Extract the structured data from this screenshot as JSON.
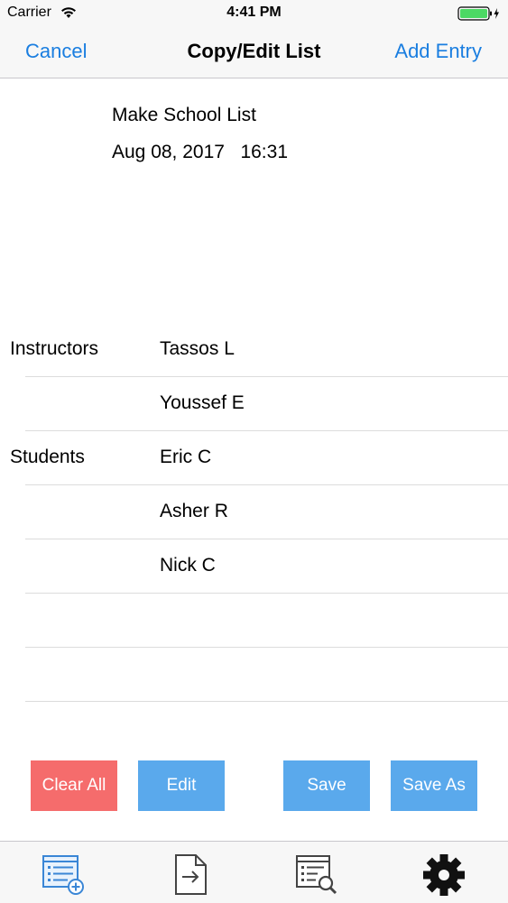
{
  "status_bar": {
    "carrier": "Carrier",
    "time": "4:41 PM",
    "battery_color": "#4cd964"
  },
  "nav": {
    "left_label": "Cancel",
    "title": "Copy/Edit List",
    "right_label": "Add Entry"
  },
  "list": {
    "title": "Make School List",
    "datetime": "Aug 08, 2017   16:31"
  },
  "rows": [
    {
      "group": "Instructors",
      "name": "Tassos L"
    },
    {
      "group": "",
      "name": "Youssef E"
    },
    {
      "group": "Students",
      "name": "Eric C"
    },
    {
      "group": "",
      "name": "Asher R"
    },
    {
      "group": "",
      "name": "Nick C"
    },
    {
      "group": "",
      "name": ""
    },
    {
      "group": "",
      "name": ""
    }
  ],
  "buttons": {
    "clear_all": "Clear All",
    "edit": "Edit",
    "save": "Save",
    "save_as": "Save As"
  },
  "colors": {
    "accent": "#1a7ee0",
    "clear_button": "#f56c6c",
    "action_button": "#5aa9ec"
  },
  "tab_bar": {
    "tabs": [
      {
        "icon": "new-list-icon"
      },
      {
        "icon": "export-document-icon"
      },
      {
        "icon": "search-list-icon"
      },
      {
        "icon": "gear-icon"
      }
    ]
  }
}
